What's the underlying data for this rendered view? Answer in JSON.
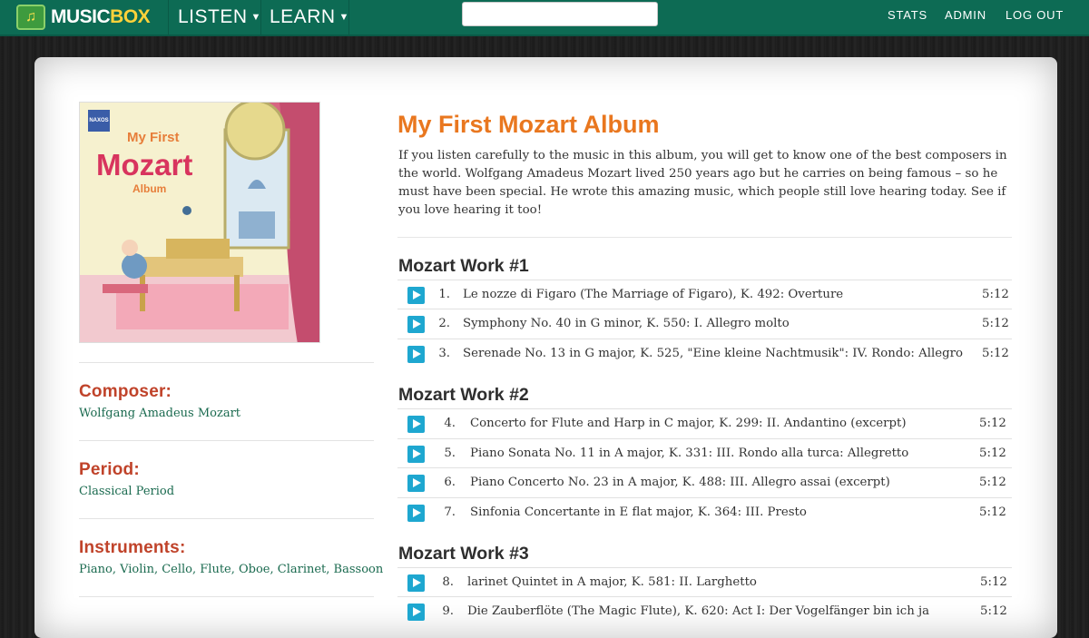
{
  "header": {
    "logo_music": "MUSIC",
    "logo_box": "BOX",
    "nav": [
      {
        "label": "LISTEN"
      },
      {
        "label": "LEARN"
      }
    ],
    "search_placeholder": "",
    "right_nav": [
      {
        "label": "STATS"
      },
      {
        "label": "ADMIN"
      },
      {
        "label": "LOG OUT"
      }
    ]
  },
  "sidebar": {
    "cover_text": {
      "line1": "My First",
      "line2": "Mozart",
      "line3": "Album",
      "label": "NAXOS"
    },
    "composer_label": "Composer:",
    "composer_value": "Wolfgang Amadeus Mozart",
    "period_label": "Period:",
    "period_value": "Classical Period",
    "instruments_label": "Instruments:",
    "instruments_value": "Piano, Violin, Cello, Flute, Oboe, Clarinet, Bassoon"
  },
  "album": {
    "title": "My First Mozart Album",
    "description": "If you listen carefully to the music in this album, you will get to know one of the best composers in the world. Wolfgang Amadeus Mozart lived 250 years ago but he carries on being famous – so he must have been special. He wrote this amazing music, which people still love hearing today. See if you love hearing it too!"
  },
  "works": [
    {
      "title": "Mozart Work #1",
      "tracks": [
        {
          "num": "1.",
          "name": "Le nozze di Figaro (The Marriage of Figaro), K. 492: Overture",
          "dur": "5:12"
        },
        {
          "num": "2.",
          "name": "Symphony No. 40 in G minor, K. 550: I. Allegro molto",
          "dur": "5:12"
        },
        {
          "num": "3.",
          "name": "Serenade No. 13 in G major, K. 525, \"Eine kleine Nachtmusik\": IV. Rondo: Allegro",
          "dur": "5:12"
        }
      ]
    },
    {
      "title": "Mozart Work #2",
      "tracks": [
        {
          "num": "4.",
          "name": "Concerto for Flute and Harp in C major, K. 299: II. Andantino (excerpt)",
          "dur": "5:12"
        },
        {
          "num": "5.",
          "name": "Piano Sonata No. 11 in A major, K. 331: III. Rondo alla turca: Allegretto",
          "dur": "5:12"
        },
        {
          "num": "6.",
          "name": "Piano Concerto No. 23 in A major, K. 488: III. Allegro assai (excerpt)",
          "dur": "5:12"
        },
        {
          "num": "7.",
          "name": "Sinfonia Concertante in E flat major, K. 364: III. Presto",
          "dur": "5:12"
        }
      ]
    },
    {
      "title": "Mozart Work #3",
      "tracks": [
        {
          "num": "8.",
          "name": "larinet Quintet in A major, K. 581: II. Larghetto",
          "dur": "5:12"
        },
        {
          "num": "9.",
          "name": "Die Zauberflöte (The Magic Flute), K. 620: Act I: Der Vogelfänger bin ich ja",
          "dur": "5:12"
        }
      ]
    }
  ]
}
